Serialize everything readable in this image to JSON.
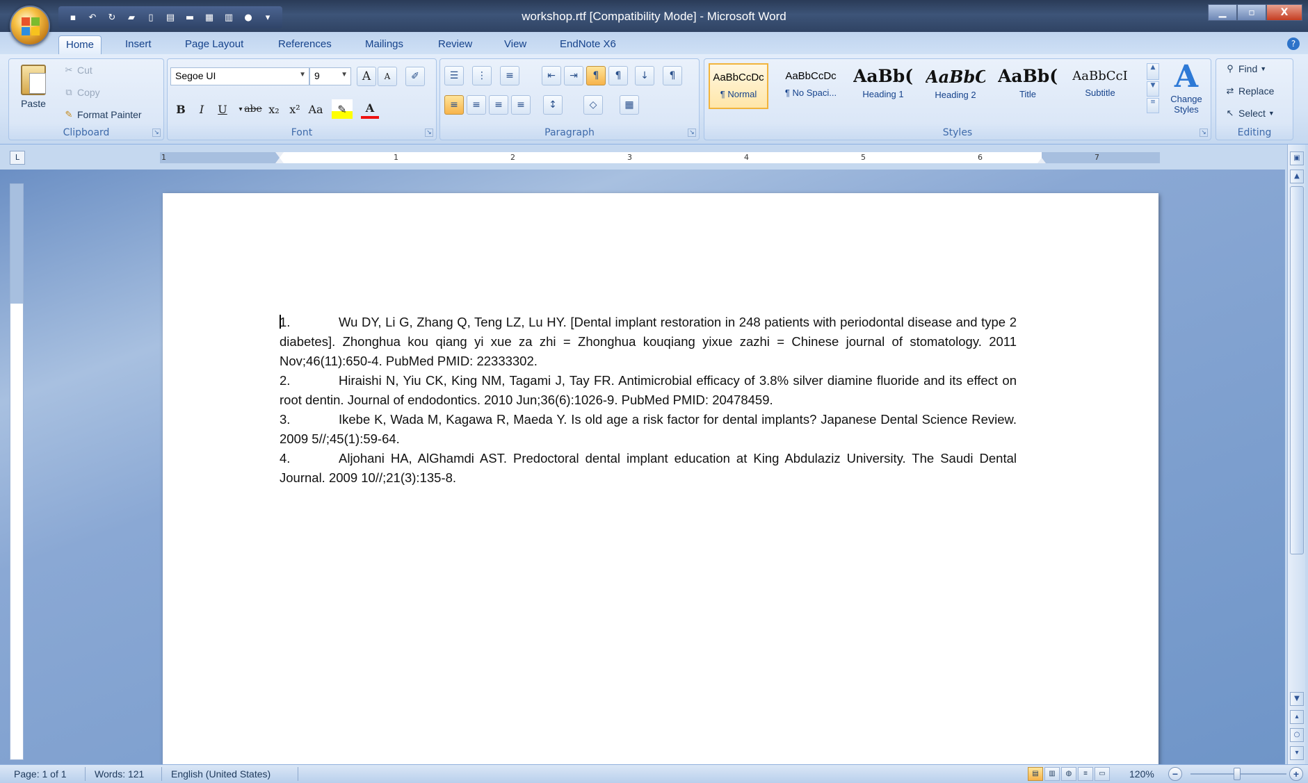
{
  "window": {
    "title": "workshop.rtf [Compatibility Mode] - Microsoft Word",
    "controls": {
      "minimize": "▁",
      "maximize": "▫",
      "close": "X"
    }
  },
  "quick_access": [
    "save-icon",
    "undo-icon",
    "redo-icon",
    "open-icon",
    "new-icon",
    "print-preview-icon",
    "spelling-icon",
    "table-icon",
    "chart-icon",
    "shape-icon",
    "customize-icon"
  ],
  "tabs": [
    "Home",
    "Insert",
    "Page Layout",
    "References",
    "Mailings",
    "Review",
    "View",
    "EndNote X6"
  ],
  "active_tab": "Home",
  "clipboard": {
    "paste": "Paste",
    "cut": "Cut",
    "copy": "Copy",
    "format_painter": "Format Painter",
    "label": "Clipboard"
  },
  "font": {
    "name": "Segoe UI",
    "size": "9",
    "label": "Font",
    "buttons": {
      "bold": "B",
      "italic": "I",
      "underline": "U",
      "strike": "abe",
      "subscript": "x₂",
      "superscript": "x²",
      "change_case": "Aa",
      "grow": "A",
      "shrink": "A"
    }
  },
  "paragraph": {
    "label": "Paragraph"
  },
  "styles": {
    "label": "Styles",
    "items": [
      {
        "sample": "AaBbCcDc",
        "name": "¶ Normal"
      },
      {
        "sample": "AaBbCcDc",
        "name": "¶ No Spaci..."
      },
      {
        "sample": "AaBb(",
        "name": "Heading 1"
      },
      {
        "sample": "AaBbC",
        "name": "Heading 2"
      },
      {
        "sample": "AaBb(",
        "name": "Title"
      },
      {
        "sample": "AaBbCcI",
        "name": "Subtitle"
      }
    ],
    "change_styles": "Change Styles"
  },
  "editing": {
    "label": "Editing",
    "find": "Find",
    "replace": "Replace",
    "select": "Select"
  },
  "ruler": {
    "numbers": [
      "1",
      "1",
      "2",
      "3",
      "4",
      "5",
      "6",
      "7"
    ]
  },
  "document": {
    "references": [
      {
        "num": "1.",
        "text": "Wu DY, Li G, Zhang Q, Teng LZ, Lu HY. [Dental implant restoration in 248 patients with periodontal disease and type 2 diabetes]. Zhonghua kou qiang yi xue za zhi = Zhonghua kouqiang yixue zazhi = Chinese journal of stomatology. 2011 Nov;46(11):650-4. PubMed PMID: 22333302."
      },
      {
        "num": "2.",
        "text": "Hiraishi N, Yiu CK, King NM, Tagami J, Tay FR. Antimicrobial efficacy of 3.8% silver diamine fluoride and its effect on root dentin. Journal of endodontics. 2010 Jun;36(6):1026-9. PubMed PMID: 20478459."
      },
      {
        "num": "3.",
        "text": "Ikebe K, Wada M, Kagawa R, Maeda Y. Is old age a risk factor for dental implants? Japanese Dental Science Review. 2009 5//;45(1):59-64."
      },
      {
        "num": "4.",
        "text": "Aljohani HA, AlGhamdi AST. Predoctoral dental implant education at King Abdulaziz University. The Saudi Dental Journal. 2009 10//;21(3):135-8."
      }
    ]
  },
  "status": {
    "page": "Page: 1 of 1",
    "words": "Words: 121",
    "language": "English (United States)",
    "zoom": "120%"
  }
}
